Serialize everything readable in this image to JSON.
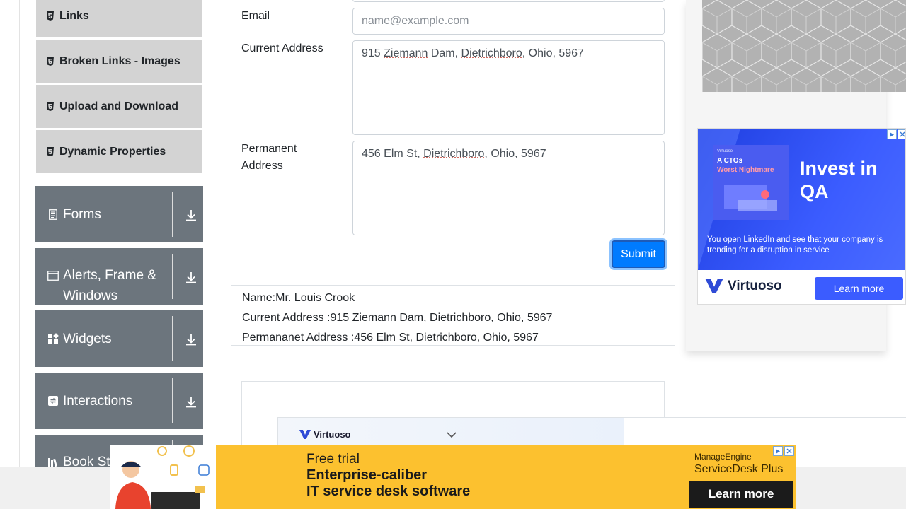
{
  "sidebar": {
    "sub_items": [
      {
        "label": "Links"
      },
      {
        "label": "Broken Links - Images"
      },
      {
        "label": "Upload and Download"
      },
      {
        "label": "Dynamic Properties"
      }
    ],
    "groups": [
      {
        "label": "Forms"
      },
      {
        "label": "Alerts, Frame & Windows"
      },
      {
        "label": "Widgets"
      },
      {
        "label": "Interactions"
      },
      {
        "label": "Book Store Application"
      }
    ]
  },
  "form": {
    "email_label": "Email",
    "email_placeholder": "name@example.com",
    "current_address_label": "Current Address",
    "current_address_parts": [
      "915 ",
      "Ziemann",
      " Dam, ",
      "Dietrichboro",
      ", Ohio, 5967"
    ],
    "permanent_address_label_line1": "Permanent",
    "permanent_address_label_line2": "Address",
    "permanent_address_parts": [
      "456 Elm St, ",
      "Dietrichboro",
      ", Ohio, 5967"
    ],
    "submit_label": "Submit"
  },
  "output": {
    "name": "Name:Mr. Louis Crook",
    "current_address": "Current Address :915 Ziemann Dam, Dietrichboro, Ohio, 5967",
    "permanent_address": "Permananet Address :456 Elm St, Dietrichboro, Ohio, 5967"
  },
  "inline_ad": {
    "brand": "Virtuoso"
  },
  "side_ad": {
    "card_brand": "Virtuoso",
    "card_title_line1": "A CTOs",
    "card_title_line2": "Worst Nightmare",
    "headline_line1": "Invest in",
    "headline_line2": "QA",
    "subtext": "You open LinkedIn and see that your company is trending for a disruption in service",
    "brand": "Virtuoso",
    "cta": "Learn more"
  },
  "bottom_banner": {
    "line1": "Free trial",
    "line2": "Enterprise-caliber",
    "line3": "IT service desk software",
    "product_line1": "ManageEngine",
    "product_line2": "ServiceDesk Plus",
    "cta": "Learn more"
  },
  "colors": {
    "primary": "#007bff",
    "sidebar_group": "#6c757d",
    "sidebar_item": "#d3d3d3",
    "banner_yellow": "#fcc12f",
    "ad_blue": "#3b5cff"
  }
}
